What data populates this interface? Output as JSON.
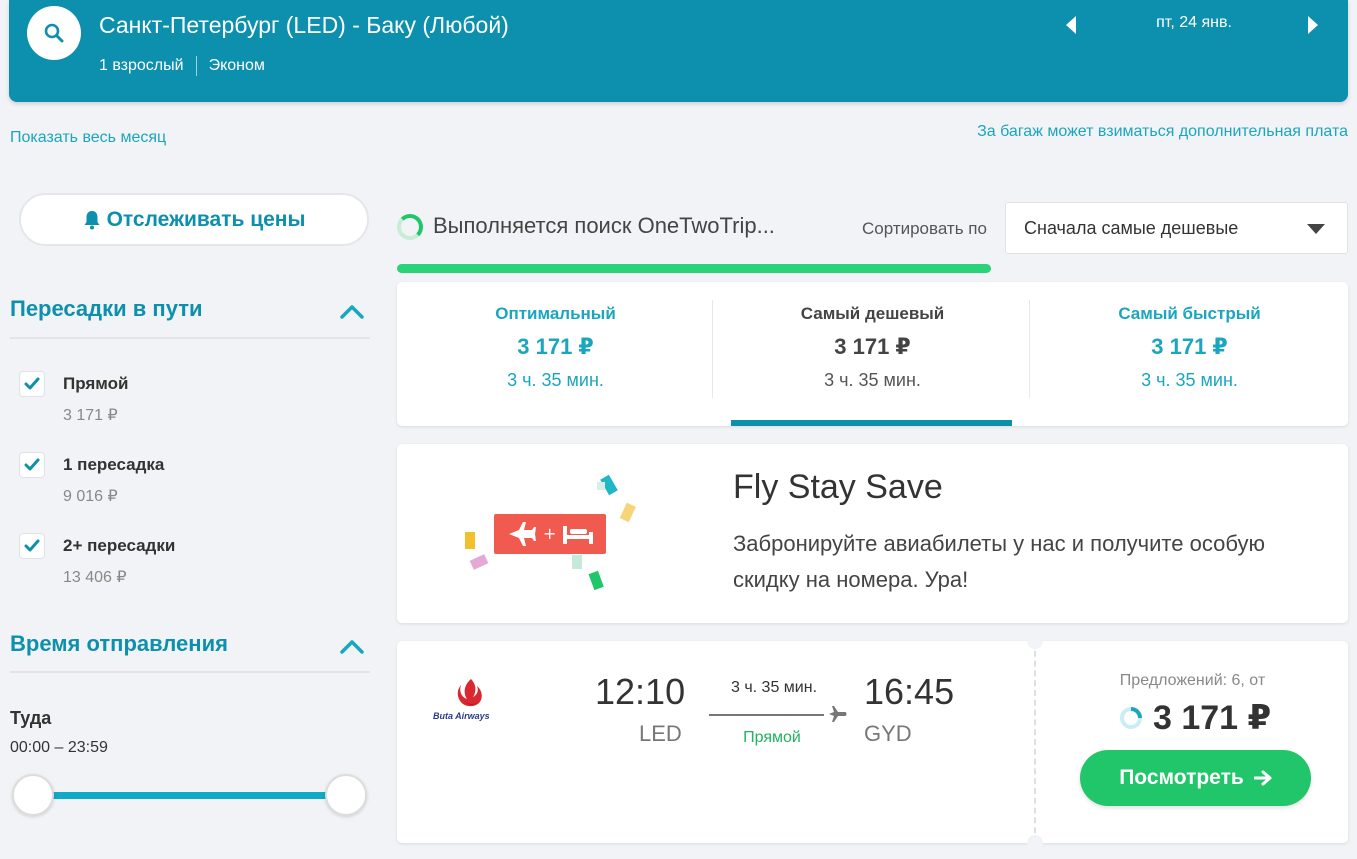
{
  "header": {
    "route": "Санкт-Петербург (LED) - Баку (Любой)",
    "passengers": "1 взрослый",
    "class": "Эконом",
    "date": "пт, 24 янв."
  },
  "links": {
    "show_month": "Показать весь месяц",
    "baggage_note": "За багаж может взиматься дополнительная плата"
  },
  "track_prices_label": "Отслеживать цены",
  "filters": {
    "stops_title": "Пересадки в пути",
    "stops": [
      {
        "label": "Прямой",
        "price": "3 171 ₽",
        "checked": true
      },
      {
        "label": "1 пересадка",
        "price": "9 016 ₽",
        "checked": true
      },
      {
        "label": "2+ пересадки",
        "price": "13 406 ₽",
        "checked": true
      }
    ],
    "departure_title": "Время отправления",
    "direction": "Туда",
    "time_range": "00:00 – 23:59"
  },
  "search_status": "Выполняется поиск OneTwoTrip...",
  "sort": {
    "label": "Сортировать по",
    "value": "Сначала самые дешевые"
  },
  "summary_tabs": [
    {
      "title": "Оптимальный",
      "price": "3 171 ₽",
      "duration": "3 ч. 35 мин."
    },
    {
      "title": "Самый дешевый",
      "price": "3 171 ₽",
      "duration": "3 ч. 35 мин."
    },
    {
      "title": "Самый быстрый",
      "price": "3 171 ₽",
      "duration": "3 ч. 35 мин."
    }
  ],
  "promo": {
    "title": "Fly Stay Save",
    "text": "Забронируйте авиабилеты у нас и получите особую скидку на номера. Ура!"
  },
  "flight": {
    "airline": "Buta Airways",
    "dep_time": "12:10",
    "dep_code": "LED",
    "arr_time": "16:45",
    "arr_code": "GYD",
    "duration": "3 ч. 35 мин.",
    "stops": "Прямой",
    "offers": "Предложений: 6, от",
    "price": "3 171 ₽",
    "view_label": "Посмотреть"
  },
  "colors": {
    "brand": "#0d90ad",
    "accent": "#1aa6bf",
    "green": "#21c66a",
    "promo_red": "#f05a4f"
  }
}
